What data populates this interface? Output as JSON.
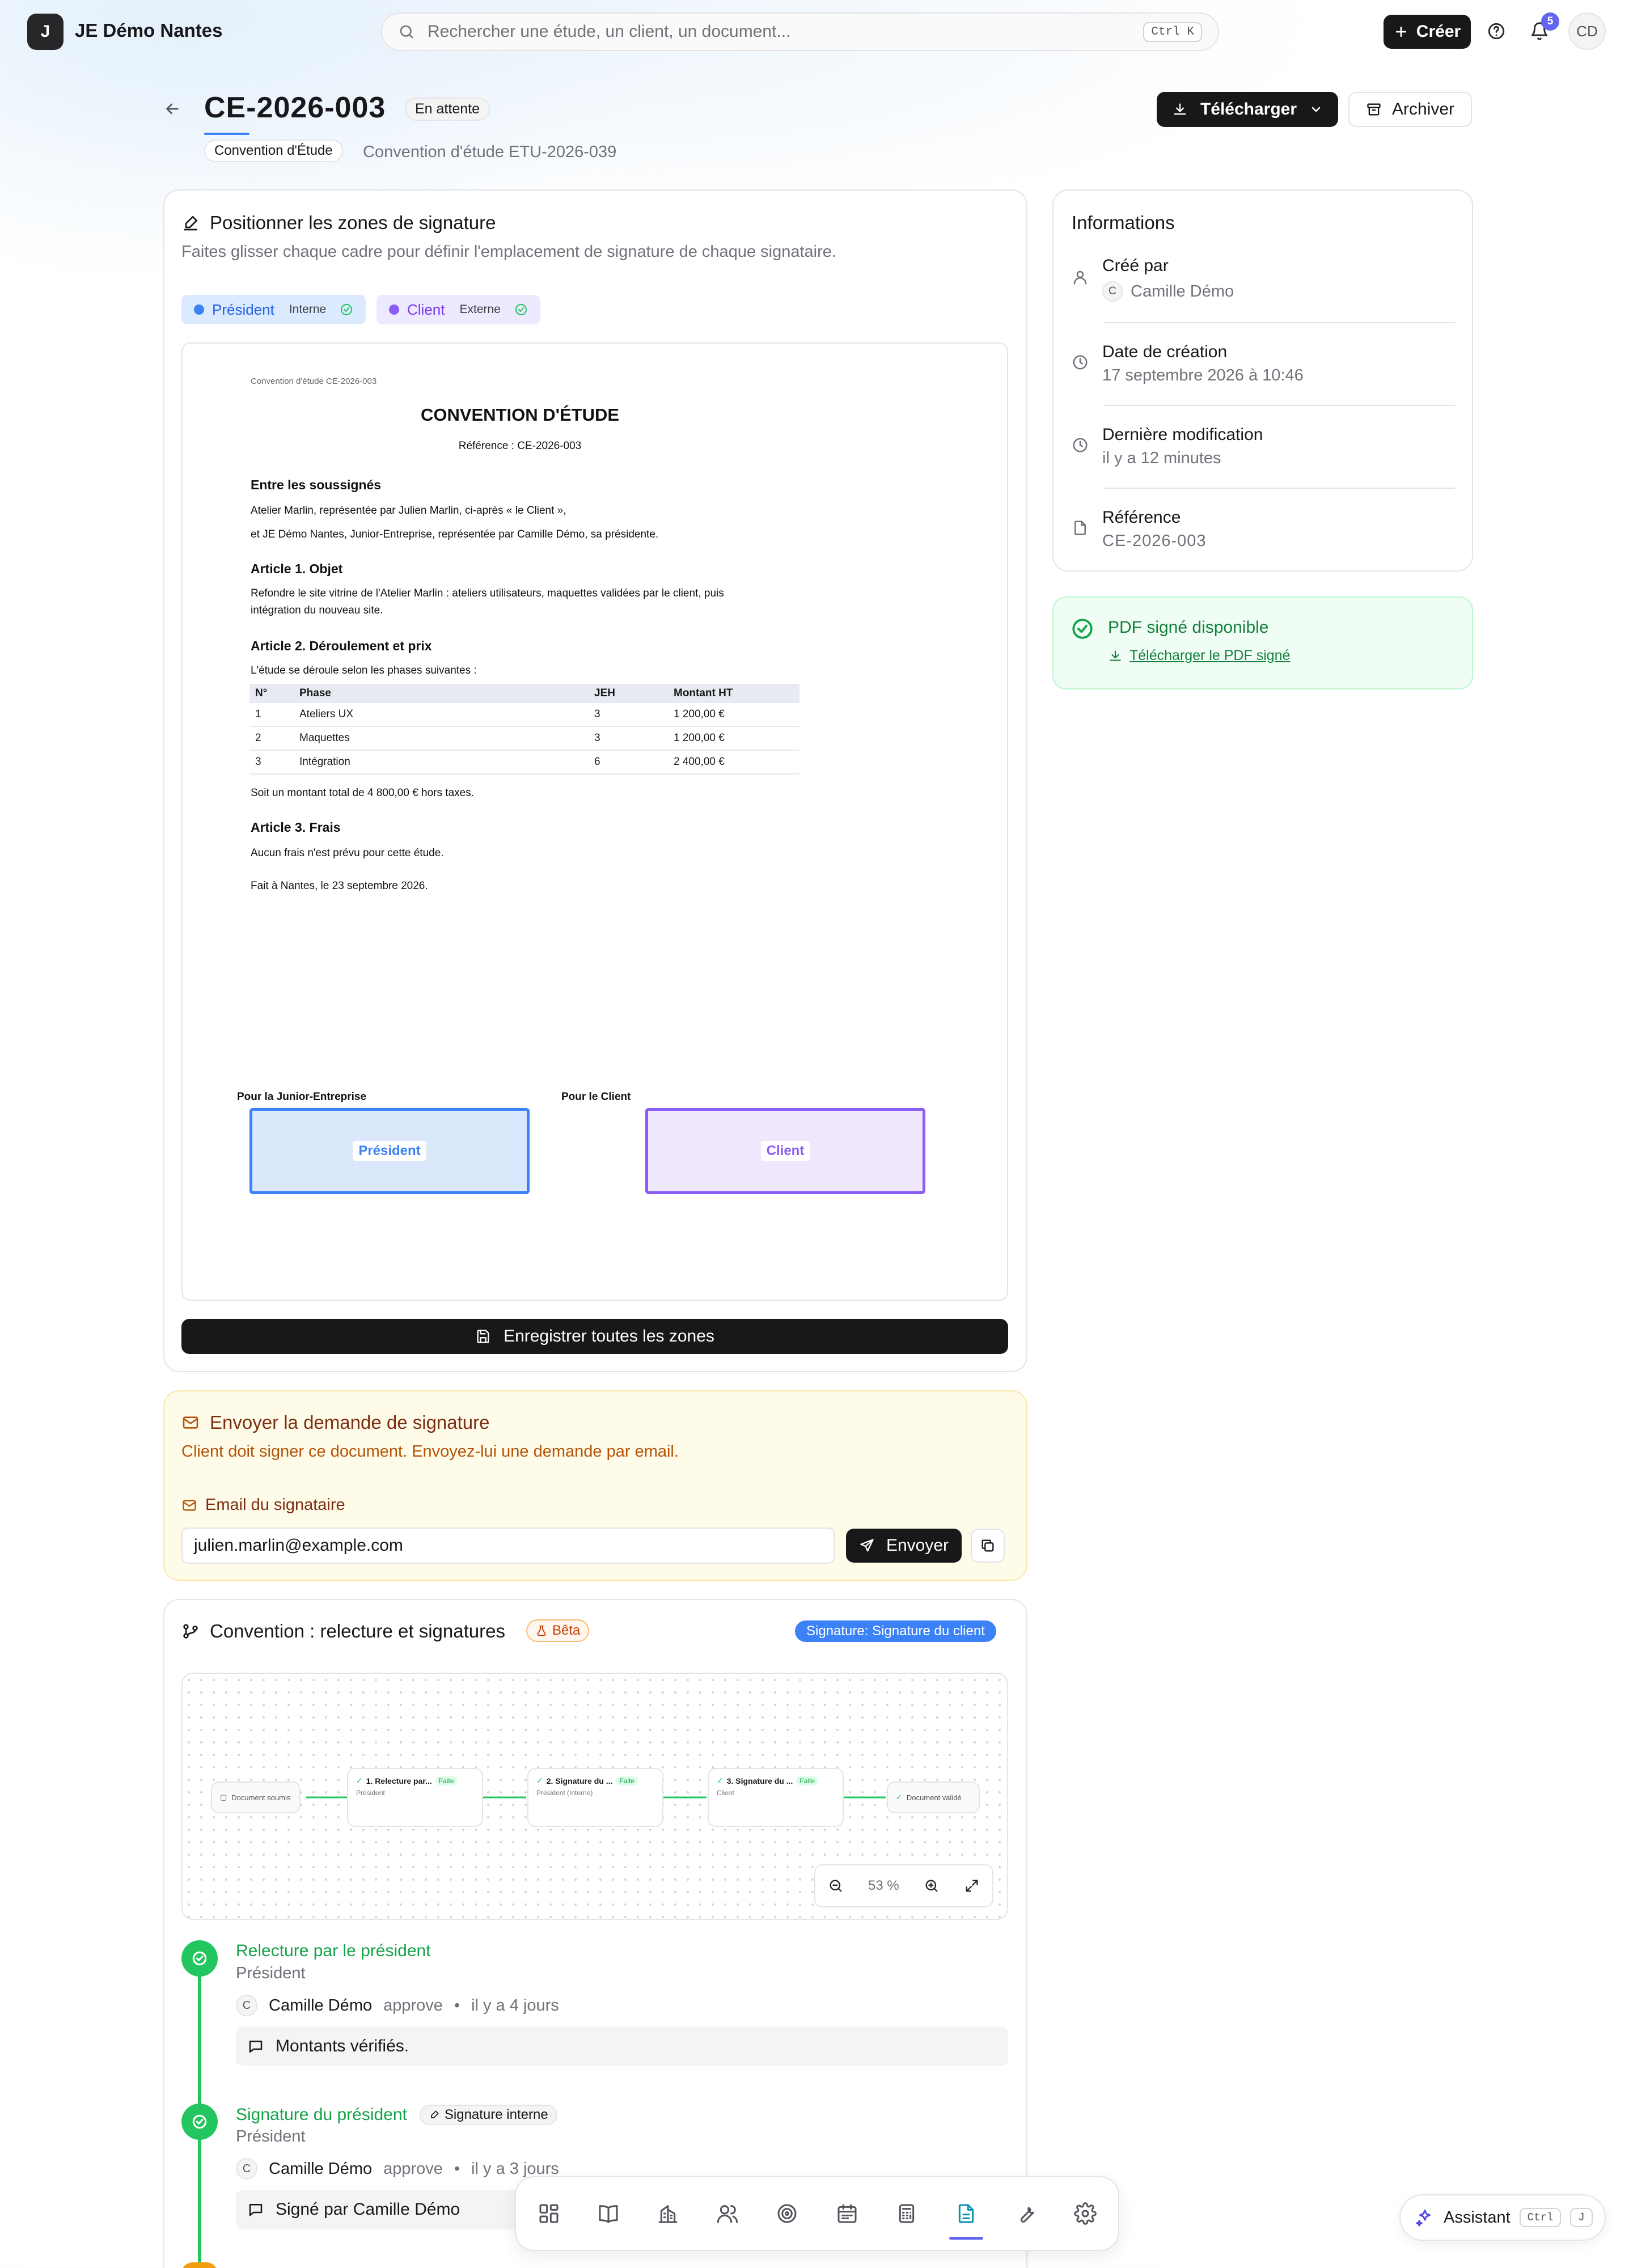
{
  "app": {
    "logo_letter": "J",
    "name": "JE Démo Nantes"
  },
  "search": {
    "placeholder": "Rechercher une étude, un client, un document...",
    "shortcut": "Ctrl K"
  },
  "header": {
    "create_label": "Créer",
    "notif_count": "5",
    "user_initials": "CD"
  },
  "page": {
    "title": "CE-2026-003",
    "status": "En attente",
    "type_badge": "Convention d'Étude",
    "subtitle": "Convention d'étude ETU-2026-039",
    "download_label": "Télécharger",
    "archive_label": "Archiver"
  },
  "zones": {
    "title": "Positionner les zones de signature",
    "description": "Faites glisser chaque cadre pour définir l'emplacement de signature de chaque signataire.",
    "signers": [
      {
        "name": "Président",
        "type": "Interne",
        "color": "#3b82f6"
      },
      {
        "name": "Client",
        "type": "Externe",
        "color": "#8b5cf6"
      }
    ],
    "save_label": "Enregistrer toutes les zones"
  },
  "doc": {
    "header": "Convention d'étude CE-2026-003",
    "title": "CONVENTION D'ÉTUDE",
    "reference": "Référence : CE-2026-003",
    "parties_title": "Entre les soussignés",
    "party1": "Atelier Marlin, représentée par Julien Marlin, ci-après « le Client »,",
    "party2": "et JE Démo Nantes, Junior-Entreprise, représentée par Camille Démo, sa présidente.",
    "a1_title": "Article 1. Objet",
    "a1_text1": "Refondre le site vitrine de l'Atelier Marlin : ateliers utilisateurs, maquettes validées par le client, puis",
    "a1_text2": "intégration du nouveau site.",
    "a2_title": "Article 2. Déroulement et prix",
    "a2_intro": "L'étude se déroule selon les phases suivantes :",
    "table": {
      "headers": [
        "N°",
        "Phase",
        "JEH",
        "Montant HT"
      ],
      "rows": [
        [
          "1",
          "Ateliers UX",
          "3",
          "1 200,00 €"
        ],
        [
          "2",
          "Maquettes",
          "3",
          "1 200,00 €"
        ],
        [
          "3",
          "Intégration",
          "6",
          "2 400,00 €"
        ]
      ]
    },
    "total": "Soit un montant total de 4 800,00 € hors taxes.",
    "a3_title": "Article 3. Frais",
    "a3_text": "Aucun frais n'est prévu pour cette étude.",
    "place_date": "Fait à Nantes, le 23 septembre 2026.",
    "sig_je_label": "Pour la Junior-Entreprise",
    "sig_client_label": "Pour le Client",
    "box_president": "Président",
    "box_client": "Client"
  },
  "send": {
    "title": "Envoyer la demande de signature",
    "description": "Client doit signer ce document. Envoyez-lui une demande par email.",
    "email_label": "Email du signataire",
    "email_value": "julien.marlin@example.com",
    "send_label": "Envoyer"
  },
  "workflow": {
    "title": "Convention : relecture et signatures",
    "beta": "Bêta",
    "current_step": "Signature: Signature du client",
    "zoom": "53 %",
    "nodes": {
      "start": "Document soumis",
      "n1": "1. Relecture par...",
      "n1_sub": "Président",
      "n2": "2. Signature du ...",
      "n2_sub": "Président (Interne)",
      "n3": "3. Signature du ...",
      "n3_sub": "Client",
      "end": "Document validé",
      "done": "Faite"
    },
    "timeline": [
      {
        "title": "Relecture par le président",
        "role": "Président",
        "actor_initial": "C",
        "actor": "Camille Démo",
        "action": "approve",
        "time": "il y a 4 jours",
        "comment": "Montants vérifiés."
      },
      {
        "title": "Signature du président",
        "tag": "Signature interne",
        "role": "Président",
        "actor_initial": "C",
        "actor": "Camille Démo",
        "action": "approve",
        "time": "il y a 3 jours",
        "comment": "Signé par Camille Démo"
      }
    ]
  },
  "info": {
    "title": "Informations",
    "created_by_label": "Créé par",
    "created_by_initial": "C",
    "created_by": "Camille Démo",
    "created_date_label": "Date de création",
    "created_date": "17 septembre 2026 à 10:46",
    "modified_label": "Dernière modification",
    "modified": "il y a 12 minutes",
    "reference_label": "Référence",
    "reference": "CE-2026-003"
  },
  "signed": {
    "title": "PDF signé disponible",
    "link": "Télécharger le PDF signé"
  },
  "assistant": {
    "label": "Assistant",
    "kbd1": "Ctrl",
    "kbd2": "J"
  },
  "colors": {
    "accent": "#18181b",
    "president_blue": "#3b82f6",
    "client_purple": "#8b5cf6",
    "success": "#22c55e",
    "warning_bg": "#fefbe8"
  }
}
